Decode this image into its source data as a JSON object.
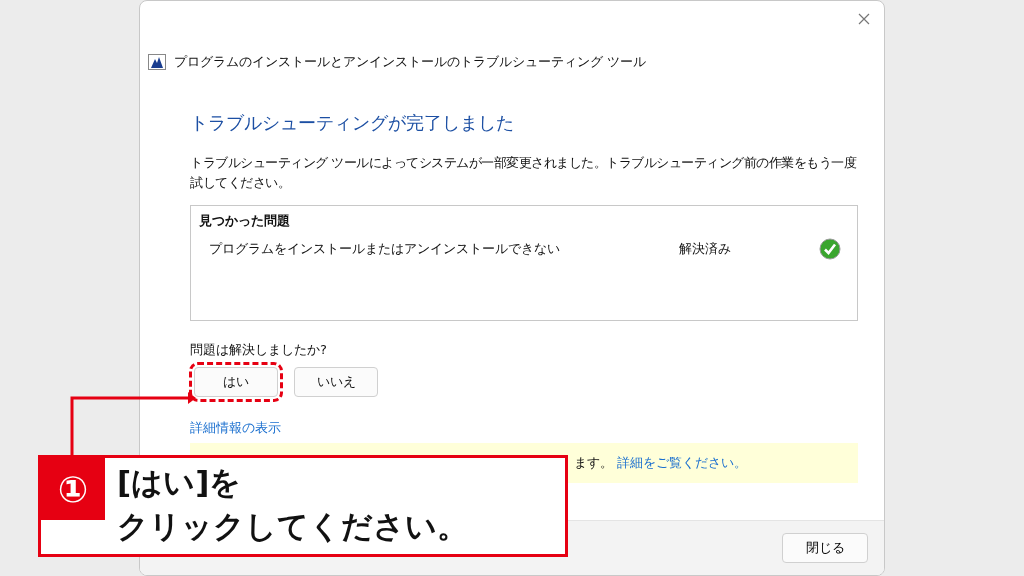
{
  "window": {
    "title": "プログラムのインストールとアンインストールのトラブルシューティング ツール"
  },
  "heading": "トラブルシューティングが完了しました",
  "description": "トラブルシューティング ツールによってシステムが一部変更されました。トラブルシューティング前の作業をもう一度試してください。",
  "problems": {
    "title": "見つかった問題",
    "items": [
      {
        "name": "プログラムをインストールまたはアンインストールできない",
        "status": "解決済み",
        "resolved": true
      }
    ]
  },
  "question": "問題は解決しましたか?",
  "answer_buttons": [
    {
      "label": "はい",
      "highlighted": true
    },
    {
      "label": "いいえ",
      "highlighted": false
    }
  ],
  "details_link": "詳細情報の表示",
  "notice": {
    "text": "ます。",
    "link": "詳細をご覧ください。"
  },
  "footer_buttons": [
    "閉じる"
  ],
  "annotation": {
    "number": "①",
    "lines": [
      "[はい]を",
      "クリックしてください。"
    ]
  }
}
